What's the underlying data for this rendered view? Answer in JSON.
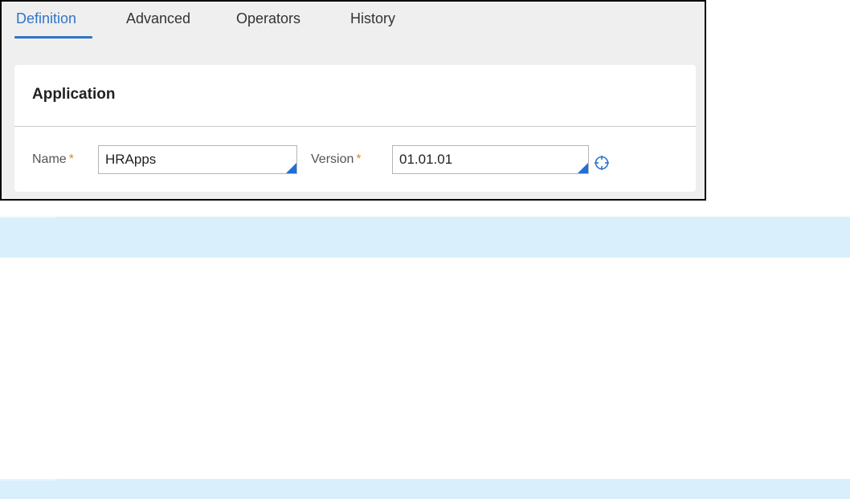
{
  "tabs": [
    {
      "label": "Definition",
      "active": true
    },
    {
      "label": "Advanced",
      "active": false
    },
    {
      "label": "Operators",
      "active": false
    },
    {
      "label": "History",
      "active": false
    }
  ],
  "section": {
    "title": "Application"
  },
  "fields": {
    "name": {
      "label": "Name",
      "required_marker": "*",
      "value": "HRApps"
    },
    "version": {
      "label": "Version",
      "required_marker": "*",
      "value": "01.01.01"
    }
  },
  "icons": {
    "version_picker": "crosshair-target-icon"
  },
  "colors": {
    "accent": "#2f75c8",
    "required": "#d9892a",
    "band": "#d9effb",
    "input_corner": "#1f6fd8"
  }
}
